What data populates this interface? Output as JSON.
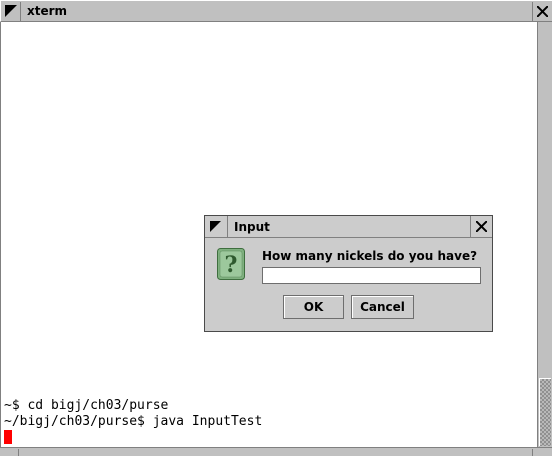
{
  "xterm": {
    "title": "xterm",
    "lines": [
      "~$ cd bigj/ch03/purse",
      "~/bigj/ch03/purse$ java InputTest"
    ]
  },
  "dialog": {
    "title": "Input",
    "message": "How many nickels do you have?",
    "input_value": "",
    "ok_label": "OK",
    "cancel_label": "Cancel",
    "icon": "question-icon"
  },
  "colors": {
    "cursor": "#ff0000",
    "chrome": "#c0c0c0",
    "dialog_bg": "#cccccc",
    "icon_green": "#6aa06a"
  }
}
